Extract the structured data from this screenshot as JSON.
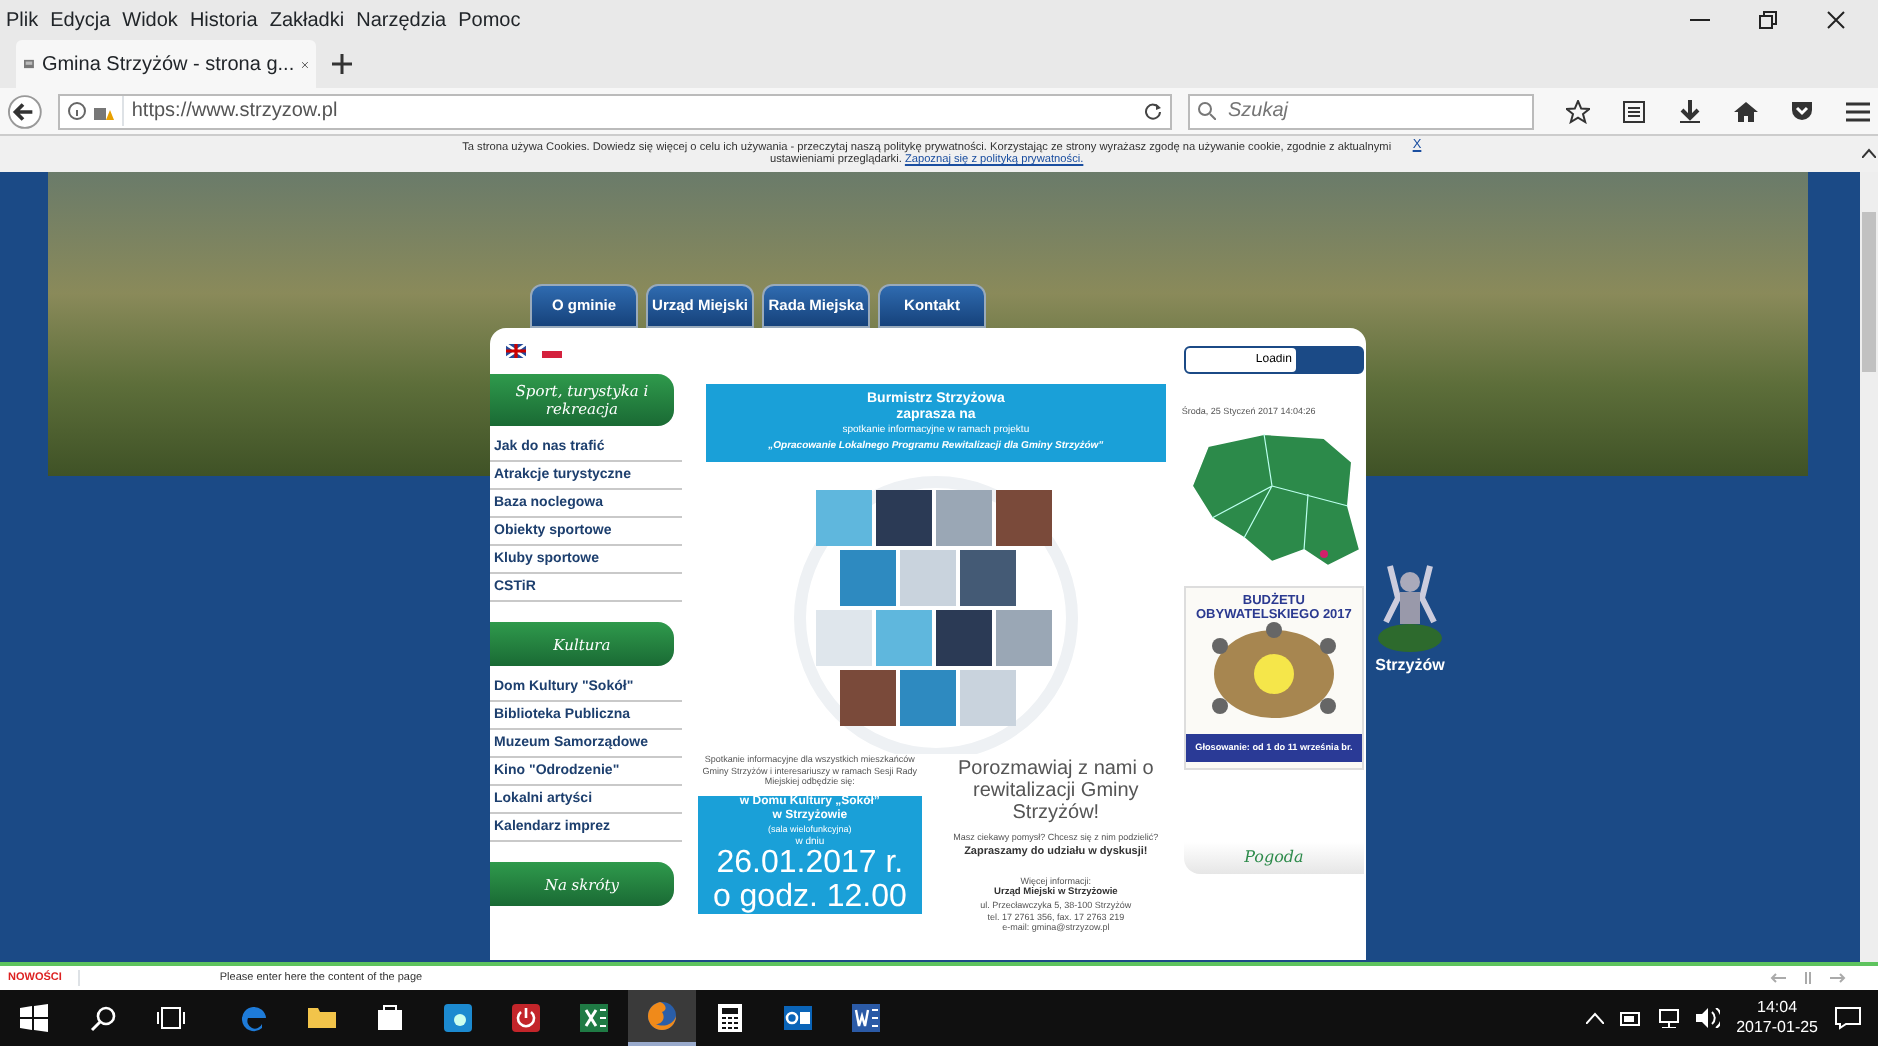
{
  "menu_bar": [
    "Plik",
    "Edycja",
    "Widok",
    "Historia",
    "Zakładki",
    "Narzędzia",
    "Pomoc"
  ],
  "tab": {
    "title": "Gmina Strzyżów - strona g...",
    "selected": true
  },
  "address_bar": {
    "url": "https://www.strzyzow.pl"
  },
  "search": {
    "placeholder": "Szukaj"
  },
  "cookie_notice": {
    "text": "Ta strona używa Cookies. Dowiedz się więcej o celu ich używania - przeczytaj naszą politykę prywatności. Korzystając ze strony wyrażasz zgodę na używanie cookie, zgodnie z aktualnymi ustawieniami przeglądarki.",
    "link": "Zapoznaj się z polityką prywatności.",
    "close": "X"
  },
  "nav": [
    "O gminie",
    "Urząd Miejski",
    "Rada Miejska",
    "Kontakt"
  ],
  "sidebar": [
    {
      "heading": "Sport, turystyka i rekreacja",
      "items": [
        "Jak do nas trafić",
        "Atrakcje turystyczne",
        "Baza noclegowa",
        "Obiekty sportowe",
        "Kluby sportowe",
        "CSTiR"
      ]
    },
    {
      "heading": "Kultura",
      "items": [
        "Dom Kultury \"Sokół\"",
        "Biblioteka Publiczna",
        "Muzeum Samorządowe",
        "Kino \"Odrodzenie\"",
        "Lokalni artyści",
        "Kalendarz imprez"
      ]
    },
    {
      "heading": "Na skróty"
    }
  ],
  "poster": {
    "header": [
      "Burmistrz Strzyżowa",
      "zaprasza na"
    ],
    "subheader": "spotkanie informacyjne w ramach projektu",
    "project": "„Opracowanie Lokalnego Programu Rewitalizacji dla Gminy Strzyżów”",
    "intro": "Spotkanie informacyjne dla wszystkich mieszkańców Gminy Strzyżów i interesariuszy w ramach Sesji Rady Miejskiej odbędzie się:",
    "venue": "w Domu Kultury „Sokół”",
    "town": "w Strzyżowie",
    "room": "(sala wielofunkcyjna)",
    "on_day": "w dniu",
    "date": "26.01.2017 r.",
    "time": "o godz. 12.00",
    "slogan": "Porozmawiaj z nami o rewitalizacji Gminy Strzyżów!",
    "question": "Masz ciekawy pomysł? Chcesz się z nim podzielić?",
    "invite": "Zapraszamy do udziału w dyskusji!",
    "more_info": "Więcej informacji:",
    "office": "Urząd Miejski w Strzyżowie",
    "address": "ul. Przecławczyka 5, 38-100 Strzyżów",
    "phone": "tel. 17 2761 356, fax. 17 2763 219",
    "email": "e-mail: gmina@strzyzow.pl"
  },
  "login_field": {
    "value": "Loadin"
  },
  "current_date": "Środa, 25 Styczeń 2017 14:04:26",
  "budget_poster": {
    "title": "BUDŻETU OBYWATELSKIEGO 2017",
    "vote": "Głosowanie: od 1 do 11 września br."
  },
  "weather": {
    "label": "Pogoda"
  },
  "emblem": {
    "caption": "Strzyżów"
  },
  "ticker": {
    "label": "NOWOŚCI",
    "text": "Please enter here the content of the page"
  },
  "taskbar": {
    "apps": [
      {
        "kind": "edge",
        "selected": false
      },
      {
        "kind": "explorer",
        "selected": false
      },
      {
        "kind": "store",
        "selected": false
      },
      {
        "kind": "app",
        "selected": false
      },
      {
        "kind": "power",
        "selected": false
      },
      {
        "kind": "excel",
        "selected": false
      },
      {
        "kind": "firefox",
        "selected": true
      },
      {
        "kind": "calculator",
        "selected": false
      },
      {
        "kind": "outlook",
        "selected": false
      },
      {
        "kind": "word",
        "selected": false
      }
    ],
    "time": "14:04",
    "date": "2017-01-25"
  }
}
